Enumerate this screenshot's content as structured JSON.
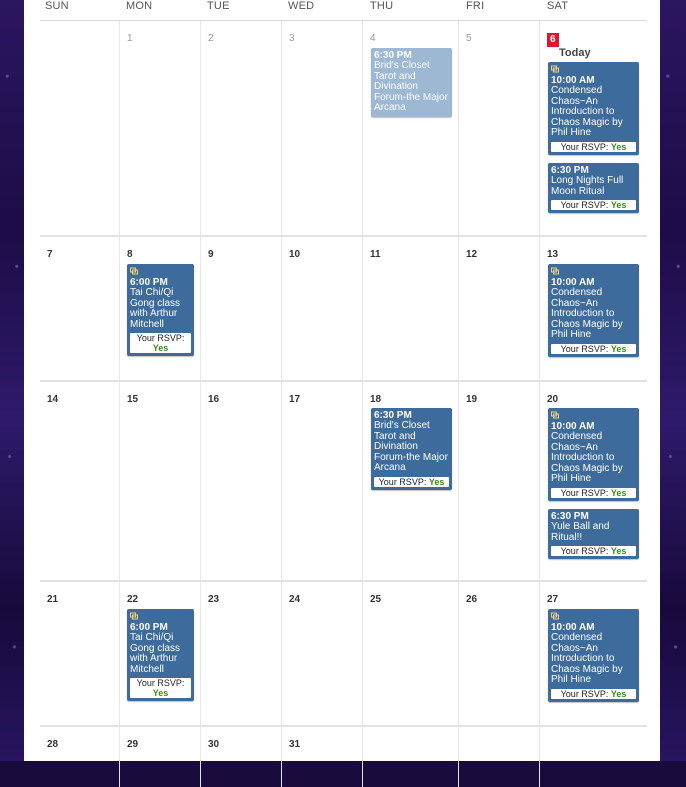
{
  "weekdays": [
    "SUN",
    "MON",
    "TUE",
    "WED",
    "THU",
    "FRI",
    "SAT"
  ],
  "today_label": "Today",
  "rsvp_label": "Your RSVP:",
  "rsvp_value": "Yes",
  "weeks": [
    [
      "",
      "1",
      "2",
      "3",
      "4",
      "5",
      "6"
    ],
    [
      "7",
      "8",
      "9",
      "10",
      "11",
      "12",
      "13"
    ],
    [
      "14",
      "15",
      "16",
      "17",
      "18",
      "19",
      "20"
    ],
    [
      "21",
      "22",
      "23",
      "24",
      "25",
      "26",
      "27"
    ],
    [
      "28",
      "29",
      "30",
      "31",
      "",
      "",
      ""
    ]
  ],
  "events": {
    "thu4": {
      "time": "6:30 PM",
      "title": "Brid's Closet Tarot and Divination Forum-the Major Arcana"
    },
    "sat6a": {
      "time": "10:00 AM",
      "title": "Condensed Chaos~An Introduction to Chaos Magic by Phil Hine"
    },
    "sat6b": {
      "time": "6:30 PM",
      "title": "Long Nights Full Moon Ritual"
    },
    "mon8": {
      "time": "6:00 PM",
      "title": "Tai Chi/Qi Gong class with Arthur Mitchell"
    },
    "sat13": {
      "time": "10:00 AM",
      "title": "Condensed Chaos~An Introduction to Chaos Magic by Phil Hine"
    },
    "thu18": {
      "time": "6:30 PM",
      "title": "Brid's Closet Tarot and Divination Forum-the Major Arcana"
    },
    "sat20a": {
      "time": "10:00 AM",
      "title": "Condensed Chaos~An Introduction to Chaos Magic by Phil Hine"
    },
    "sat20b": {
      "time": "6:30 PM",
      "title": "Yule Ball and Ritual!!"
    },
    "mon22": {
      "time": "6:00 PM",
      "title": "Tai Chi/Qi Gong class with Arthur Mitchell"
    },
    "sat27": {
      "time": "10:00 AM",
      "title": "Condensed Chaos~An Introduction to Chaos Magic by Phil Hine"
    }
  },
  "colors": {
    "event": "#3d6b9c",
    "event_past": "#9db8d3",
    "today": "#e0142d",
    "rsvp_yes": "#3b8a1a"
  }
}
